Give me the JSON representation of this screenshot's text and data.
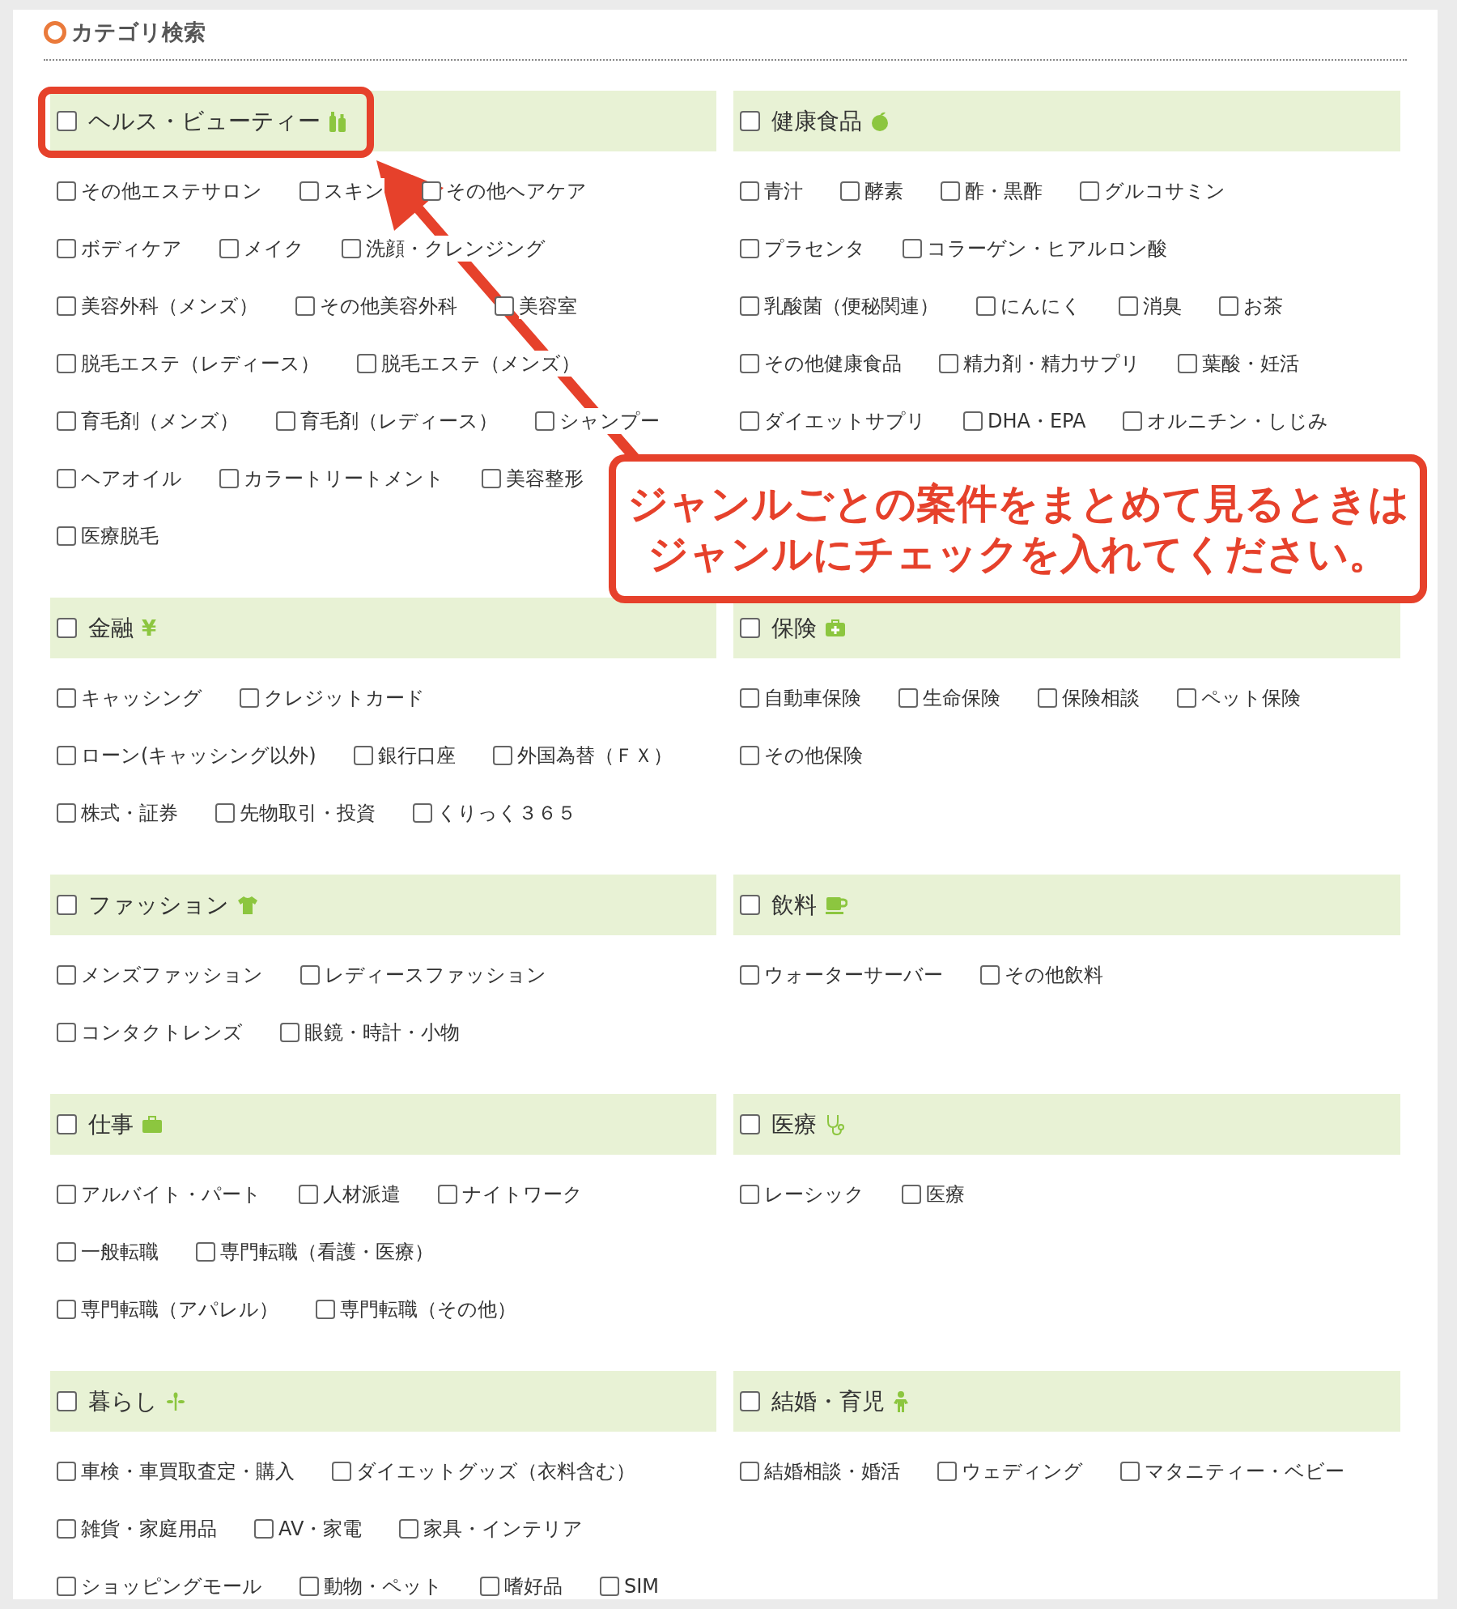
{
  "title": "カテゴリ検索",
  "categories": [
    {
      "name": "ヘルス・ビューティー",
      "kind": "bottles",
      "checked": false,
      "option_lines": [
        [
          {
            "label": "その他エステサロン",
            "checked": false
          },
          {
            "label": "スキン",
            "checked": false
          },
          {
            "label": "その他ヘアケア",
            "checked": false
          }
        ],
        [
          {
            "label": "ボディケア",
            "checked": false
          },
          {
            "label": "メイク",
            "checked": false
          },
          {
            "label": "洗顔・クレンジング",
            "checked": false
          }
        ],
        [
          {
            "label": "美容外科（メンズ）",
            "checked": false
          },
          {
            "label": "その他美容外科",
            "checked": false
          },
          {
            "label": "美容室",
            "checked": false
          }
        ],
        [
          {
            "label": "脱毛エステ（レディース）",
            "checked": false
          },
          {
            "label": "脱毛エステ（メンズ）",
            "checked": false
          }
        ],
        [
          {
            "label": "育毛剤（メンズ）",
            "checked": false
          },
          {
            "label": "育毛剤（レディース）",
            "checked": false
          },
          {
            "label": "シャンプー",
            "checked": false
          }
        ],
        [
          {
            "label": "ヘアオイル",
            "checked": false
          },
          {
            "label": "カラートリートメント",
            "checked": false
          },
          {
            "label": "美容整形",
            "checked": false
          }
        ],
        [
          {
            "label": "医療脱毛",
            "checked": false
          }
        ]
      ]
    },
    {
      "name": "健康食品",
      "kind": "apple",
      "checked": false,
      "option_lines": [
        [
          {
            "label": "青汁",
            "checked": false
          },
          {
            "label": "酵素",
            "checked": false
          },
          {
            "label": "酢・黒酢",
            "checked": false
          },
          {
            "label": "グルコサミン",
            "checked": false
          }
        ],
        [
          {
            "label": "プラセンタ",
            "checked": false
          },
          {
            "label": "コラーゲン・ヒアルロン酸",
            "checked": false
          }
        ],
        [
          {
            "label": "乳酸菌（便秘関連）",
            "checked": false
          },
          {
            "label": "にんにく",
            "checked": false
          },
          {
            "label": "消臭",
            "checked": false
          },
          {
            "label": "お茶",
            "checked": false
          }
        ],
        [
          {
            "label": "その他健康食品",
            "checked": false
          },
          {
            "label": "精力剤・精力サプリ",
            "checked": false
          },
          {
            "label": "葉酸・妊活",
            "checked": false
          }
        ],
        [
          {
            "label": "ダイエットサプリ",
            "checked": false
          },
          {
            "label": "DHA・EPA",
            "checked": false
          },
          {
            "label": "オルニチン・しじみ",
            "checked": false
          }
        ]
      ]
    },
    {
      "name": "金融",
      "kind": "yen",
      "symbol": "¥",
      "checked": false,
      "option_lines": [
        [
          {
            "label": "キャッシング",
            "checked": false
          },
          {
            "label": "クレジットカード",
            "checked": false
          }
        ],
        [
          {
            "label": "ローン(キャッシング以外)",
            "checked": false
          },
          {
            "label": "銀行口座",
            "checked": false
          },
          {
            "label": "外国為替（ＦＸ）",
            "checked": false
          }
        ],
        [
          {
            "label": "株式・証券",
            "checked": false
          },
          {
            "label": "先物取引・投資",
            "checked": false
          },
          {
            "label": "くりっく３６５",
            "checked": false
          }
        ]
      ]
    },
    {
      "name": "保険",
      "kind": "medkit",
      "checked": false,
      "option_lines": [
        [
          {
            "label": "自動車保険",
            "checked": false
          },
          {
            "label": "生命保険",
            "checked": false
          },
          {
            "label": "保険相談",
            "checked": false
          },
          {
            "label": "ペット保険",
            "checked": false
          }
        ],
        [
          {
            "label": "その他保険",
            "checked": false
          }
        ]
      ]
    },
    {
      "name": "ファッション",
      "kind": "shirt",
      "checked": false,
      "option_lines": [
        [
          {
            "label": "メンズファッション",
            "checked": false
          },
          {
            "label": "レディースファッション",
            "checked": false
          }
        ],
        [
          {
            "label": "コンタクトレンズ",
            "checked": false
          },
          {
            "label": "眼鏡・時計・小物",
            "checked": false
          }
        ]
      ]
    },
    {
      "name": "飲料",
      "kind": "cup",
      "checked": false,
      "option_lines": [
        [
          {
            "label": "ウォーターサーバー",
            "checked": false
          },
          {
            "label": "その他飲料",
            "checked": false
          }
        ]
      ]
    },
    {
      "name": "仕事",
      "kind": "briefcase",
      "checked": false,
      "option_lines": [
        [
          {
            "label": "アルバイト・パート",
            "checked": false
          },
          {
            "label": "人材派遣",
            "checked": false
          },
          {
            "label": "ナイトワーク",
            "checked": false
          }
        ],
        [
          {
            "label": "一般転職",
            "checked": false
          },
          {
            "label": "専門転職（看護・医療）",
            "checked": false
          }
        ],
        [
          {
            "label": "専門転職（アパレル）",
            "checked": false
          },
          {
            "label": "専門転職（その他）",
            "checked": false
          }
        ]
      ]
    },
    {
      "name": "医療",
      "kind": "stethoscope",
      "checked": false,
      "option_lines": [
        [
          {
            "label": "レーシック",
            "checked": false
          },
          {
            "label": "医療",
            "checked": false
          }
        ]
      ]
    },
    {
      "name": "暮らし",
      "kind": "sprout",
      "checked": false,
      "option_lines": [
        [
          {
            "label": "車検・車買取査定・購入",
            "checked": false
          },
          {
            "label": "ダイエットグッズ（衣料含む）",
            "checked": false
          }
        ],
        [
          {
            "label": "雑貨・家庭用品",
            "checked": false
          },
          {
            "label": "AV・家電",
            "checked": false
          },
          {
            "label": "家具・インテリア",
            "checked": false
          }
        ],
        [
          {
            "label": "ショッピングモール",
            "checked": false
          },
          {
            "label": "動物・ペット",
            "checked": false
          },
          {
            "label": "嗜好品",
            "checked": false
          },
          {
            "label": "SIM",
            "checked": false
          }
        ]
      ]
    },
    {
      "name": "結婚・育児",
      "kind": "child",
      "checked": false,
      "option_lines": [
        [
          {
            "label": "結婚相談・婚活",
            "checked": false
          },
          {
            "label": "ウェディング",
            "checked": false
          },
          {
            "label": "マタニティー・ベビー",
            "checked": false
          }
        ]
      ]
    }
  ],
  "annotation": {
    "callout_lines": [
      "ジャンルごとの案件をまとめて見るときは",
      "ジャンルにチェックを入れてください。"
    ]
  }
}
